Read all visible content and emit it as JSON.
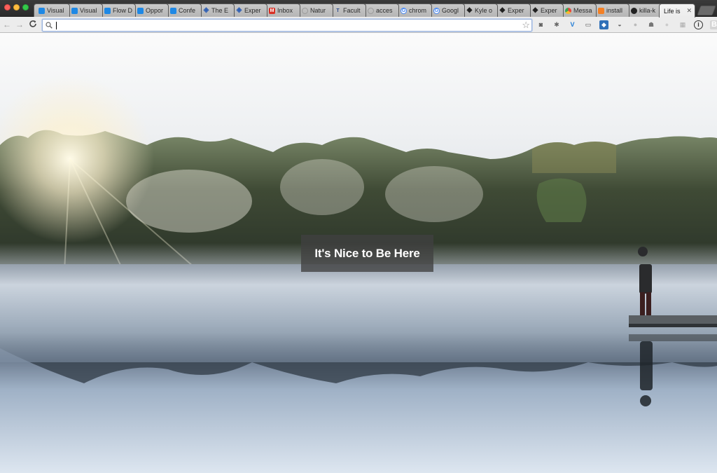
{
  "window": {
    "buttons": [
      "close",
      "minimize",
      "zoom"
    ]
  },
  "tabs": [
    {
      "label": "Visual",
      "icon": "vs-icon",
      "color": "#1e88e5"
    },
    {
      "label": "Visual",
      "icon": "vs-icon",
      "color": "#1e88e5"
    },
    {
      "label": "Flow D",
      "icon": "vs-icon",
      "color": "#1e88e5"
    },
    {
      "label": "Oppor",
      "icon": "vs-icon",
      "color": "#1e88e5"
    },
    {
      "label": "Confe",
      "icon": "vs-icon",
      "color": "#1e88e5"
    },
    {
      "label": "The E",
      "icon": "eye-icon",
      "color": "#2f5fb3"
    },
    {
      "label": "Exper",
      "icon": "eye-icon",
      "color": "#2f5fb3"
    },
    {
      "label": "Inbox",
      "icon": "gmail-icon",
      "color": "#d93025"
    },
    {
      "label": "Natur",
      "icon": "blank-icon",
      "color": "#888888"
    },
    {
      "label": "Facult",
      "icon": "tulsa-icon",
      "color": "#2b4a8b"
    },
    {
      "label": "acces",
      "icon": "blank-icon",
      "color": "#888888"
    },
    {
      "label": "chrom",
      "icon": "google-icon",
      "color": "#4285f4"
    },
    {
      "label": "Googl",
      "icon": "google-icon",
      "color": "#4285f4"
    },
    {
      "label": "Kyle o",
      "icon": "codepen-icon",
      "color": "#222222"
    },
    {
      "label": "Exper",
      "icon": "codepen-icon",
      "color": "#222222"
    },
    {
      "label": "Exper",
      "icon": "codepen-icon",
      "color": "#222222"
    },
    {
      "label": "Messa",
      "icon": "chrome-icon",
      "color": "#e8453c"
    },
    {
      "label": "install",
      "icon": "stackoverflow-icon",
      "color": "#f48024"
    },
    {
      "label": "killa-k",
      "icon": "github-icon",
      "color": "#222222"
    },
    {
      "label": "Life is",
      "icon": "blank-icon",
      "color": "#888888",
      "active": true
    }
  ],
  "toolbar": {
    "back": "←",
    "forward": "→",
    "reload": "C",
    "omnibox_value": "",
    "bookmark_star": "☆"
  },
  "extensions": [
    {
      "name": "pocket-icon",
      "glyph": "◙",
      "color": "#555555"
    },
    {
      "name": "bug-icon",
      "glyph": "✱",
      "color": "#666666"
    },
    {
      "name": "vue-devtools-icon",
      "glyph": "V",
      "color": "#1e7bd6"
    },
    {
      "name": "cast-icon",
      "glyph": "▭",
      "color": "#555555"
    },
    {
      "name": "feedly-icon",
      "glyph": "◆",
      "color": "#3070b8"
    },
    {
      "name": "shield-icon",
      "glyph": "◒",
      "color": "#666666"
    },
    {
      "name": "disabled-icon",
      "glyph": "●",
      "color": "#bbbbbb"
    },
    {
      "name": "ghostery-icon",
      "glyph": "☗",
      "color": "#777777"
    },
    {
      "name": "chat-icon",
      "glyph": "●",
      "color": "#cccccc"
    },
    {
      "name": "grid-icon",
      "glyph": "▦",
      "color": "#aaaaaa"
    },
    {
      "name": "info-icon",
      "glyph": "i",
      "color": "#333333"
    },
    {
      "name": "b-extension-icon",
      "glyph": "B",
      "color": "#888888"
    }
  ],
  "page": {
    "hero_title": "It's Nice to Be Here"
  },
  "colors": {
    "tabstrip": "#2e2e2e",
    "toolbar": "#ececec",
    "hero_box": "#404040"
  }
}
